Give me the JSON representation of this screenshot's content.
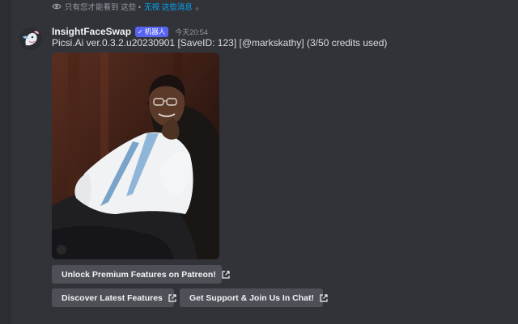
{
  "ephemeral_notice": {
    "text": "只有您才能看到 这些 •",
    "dismiss_label": "无视 这些消息",
    "end": "。",
    "icon": "eye-icon"
  },
  "message": {
    "author": "InsightFaceSwap",
    "bot_badge": "机器人",
    "timestamp": "今天20:54",
    "content": "Picsi.Ai ver.0.3.2.u20230901 [SaveID: 123] [@markskathy] (3/50 credits used)"
  },
  "buttons": {
    "premium": "Unlock Premium Features on Patreon!",
    "discover": "Discover Latest Features",
    "support": "Get Support & Join Us In Chat!"
  },
  "colors": {
    "background": "#313338",
    "button": "#4e5058",
    "badge": "#5865f2",
    "link": "#00a8fc"
  }
}
